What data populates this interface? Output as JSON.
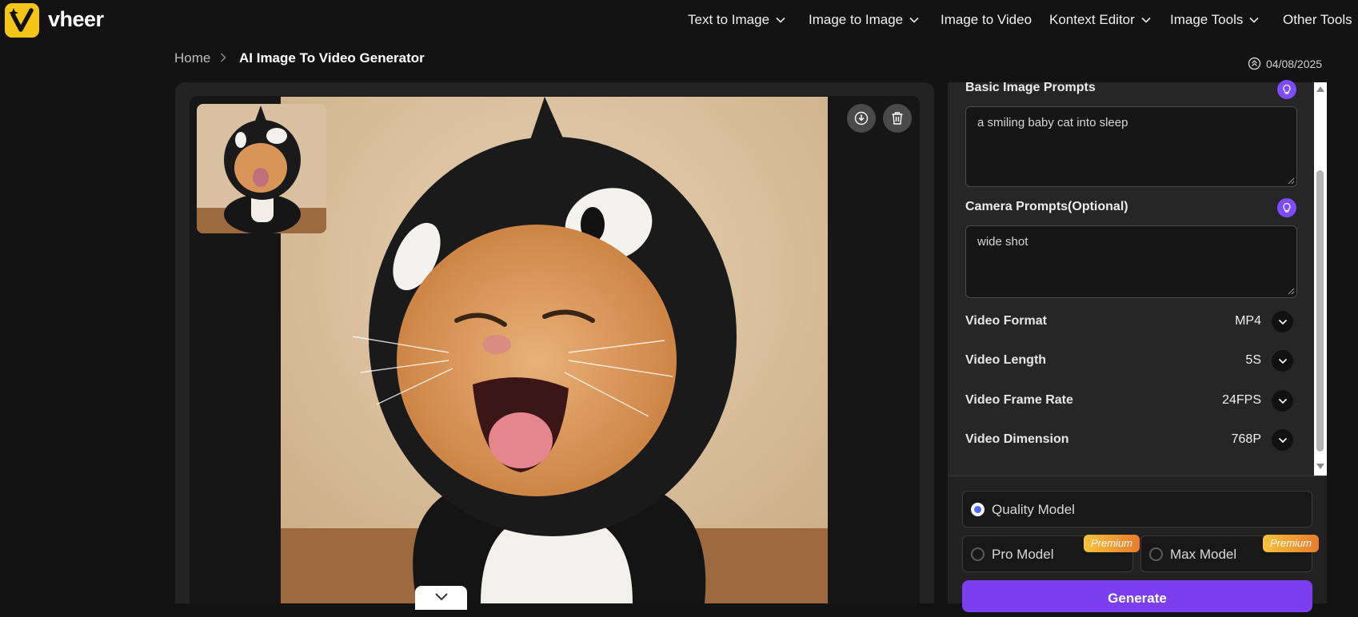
{
  "header": {
    "brand": "vheer",
    "nav": [
      {
        "label": "Text to Image",
        "has_dropdown": true
      },
      {
        "label": "Image to Image",
        "has_dropdown": true
      },
      {
        "label": "Image to Video",
        "has_dropdown": false
      },
      {
        "label": "Kontext Editor",
        "has_dropdown": true
      },
      {
        "label": "Image Tools",
        "has_dropdown": true
      },
      {
        "label": "Other Tools",
        "has_dropdown": false
      }
    ]
  },
  "breadcrumb": {
    "home": "Home",
    "current": "AI Image To Video Generator"
  },
  "date": "04/08/2025",
  "preview": {
    "download_icon": "download-icon",
    "delete_icon": "trash-icon",
    "collapse_icon": "chevron-down-icon"
  },
  "settings": {
    "basic_prompt": {
      "label": "Basic Image Prompts",
      "value": "a smiling baby cat into sleep"
    },
    "camera_prompt": {
      "label": "Camera Prompts(Optional)",
      "value": "wide shot"
    },
    "options": [
      {
        "label": "Video Format",
        "value": "MP4"
      },
      {
        "label": "Video Length",
        "value": "5S"
      },
      {
        "label": "Video Frame Rate",
        "value": "24FPS"
      },
      {
        "label": "Video Dimension",
        "value": "768P"
      }
    ]
  },
  "models": {
    "quality": {
      "label": "Quality Model",
      "selected": true
    },
    "pro": {
      "label": "Pro Model",
      "badge": "Premium",
      "selected": false
    },
    "max": {
      "label": "Max Model",
      "badge": "Premium",
      "selected": false
    }
  },
  "generate_label": "Generate",
  "colors": {
    "accent": "#7b3ff0",
    "brand_yellow": "#f5c518",
    "idea_button": "#7c4dff",
    "radio_selected": "#4f6bff"
  }
}
